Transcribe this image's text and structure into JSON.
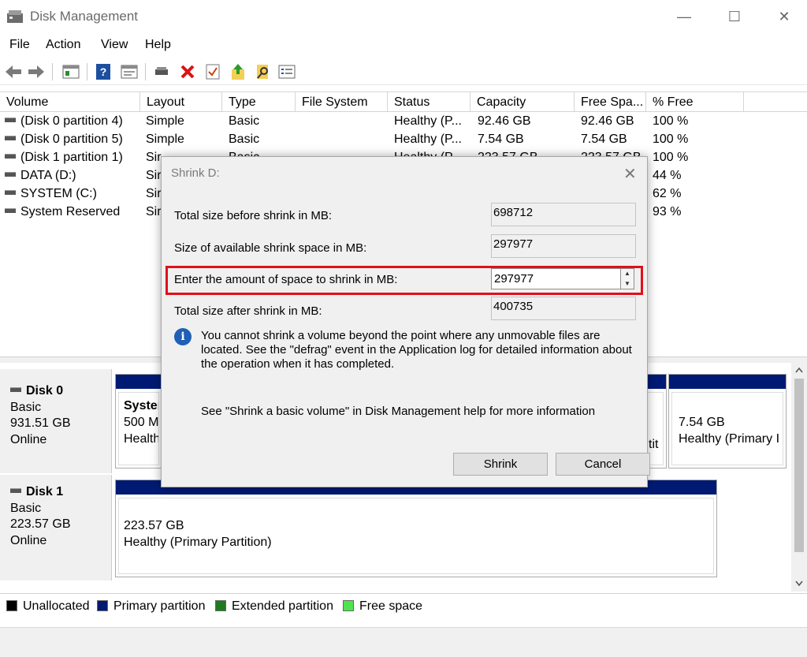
{
  "window": {
    "title": "Disk Management",
    "minimize": "—",
    "maximize": "☐",
    "close": "✕"
  },
  "menu": [
    "File",
    "Action",
    "View",
    "Help"
  ],
  "columns": [
    "Volume",
    "Layout",
    "Type",
    "File System",
    "Status",
    "Capacity",
    "Free Spa...",
    "% Free"
  ],
  "volumes": [
    {
      "volume": "(Disk 0 partition 4)",
      "layout": "Simple",
      "type": "Basic",
      "fs": "",
      "status": "Healthy (P...",
      "capacity": "92.46 GB",
      "free": "92.46 GB",
      "pct": "100 %"
    },
    {
      "volume": "(Disk 0 partition 5)",
      "layout": "Simple",
      "type": "Basic",
      "fs": "",
      "status": "Healthy (P...",
      "capacity": "7.54 GB",
      "free": "7.54 GB",
      "pct": "100 %"
    },
    {
      "volume": "(Disk 1 partition 1)",
      "layout": "Sir",
      "type": "Basic",
      "fs": "",
      "status": "Healthy (P...",
      "capacity": "223.57 GB",
      "free": "223.57 GB",
      "pct": "100 %"
    },
    {
      "volume": "DATA (D:)",
      "layout": "Sir",
      "type": "",
      "fs": "",
      "status": "",
      "capacity": "",
      "free": "",
      "pct": "44 %"
    },
    {
      "volume": "SYSTEM (C:)",
      "layout": "Sir",
      "type": "",
      "fs": "",
      "status": "",
      "capacity": "",
      "free": "",
      "pct": "62 %"
    },
    {
      "volume": "System Reserved",
      "layout": "Sir",
      "type": "",
      "fs": "",
      "status": "",
      "capacity": "",
      "free": "",
      "pct": "93 %"
    }
  ],
  "disks": [
    {
      "name": "Disk 0",
      "kind": "Basic",
      "size": "931.51 GB",
      "state": "Online",
      "parts": [
        {
          "l1": "System",
          "l2": "500 MB",
          "l3": "Healthy"
        },
        {
          "l1": "",
          "l2": "",
          "l3": "tit"
        },
        {
          "l1": "7.54 GB",
          "l2": "Healthy (Primary I",
          "l3": ""
        }
      ]
    },
    {
      "name": "Disk 1",
      "kind": "Basic",
      "size": "223.57 GB",
      "state": "Online",
      "parts": [
        {
          "l1": "223.57 GB",
          "l2": "Healthy (Primary Partition)",
          "l3": ""
        }
      ]
    }
  ],
  "legend": [
    {
      "label": "Unallocated",
      "color": "#000000"
    },
    {
      "label": "Primary partition",
      "color": "#001a74"
    },
    {
      "label": "Extended partition",
      "color": "#1f7a1f"
    },
    {
      "label": "Free space",
      "color": "#4ee44e"
    }
  ],
  "dialog": {
    "title": "Shrink D:",
    "close": "✕",
    "total_before_label": "Total size before shrink in MB:",
    "total_before_value": "698712",
    "available_label": "Size of available shrink space in MB:",
    "available_value": "297977",
    "amount_label": "Enter the amount of space to shrink in MB:",
    "amount_value": "297977",
    "total_after_label": "Total size after shrink in MB:",
    "total_after_value": "400735",
    "info": "You cannot shrink a volume beyond the point where any unmovable files are located. See the \"defrag\" event in the Application log for detailed information about the operation when it has completed.",
    "help": "See \"Shrink a basic volume\" in Disk Management help for more information",
    "shrink_button": "Shrink",
    "cancel_button": "Cancel"
  },
  "colors": {
    "primary": "#001a74",
    "highlight": "#e0101a",
    "info_icon": "#1f5fb5"
  }
}
